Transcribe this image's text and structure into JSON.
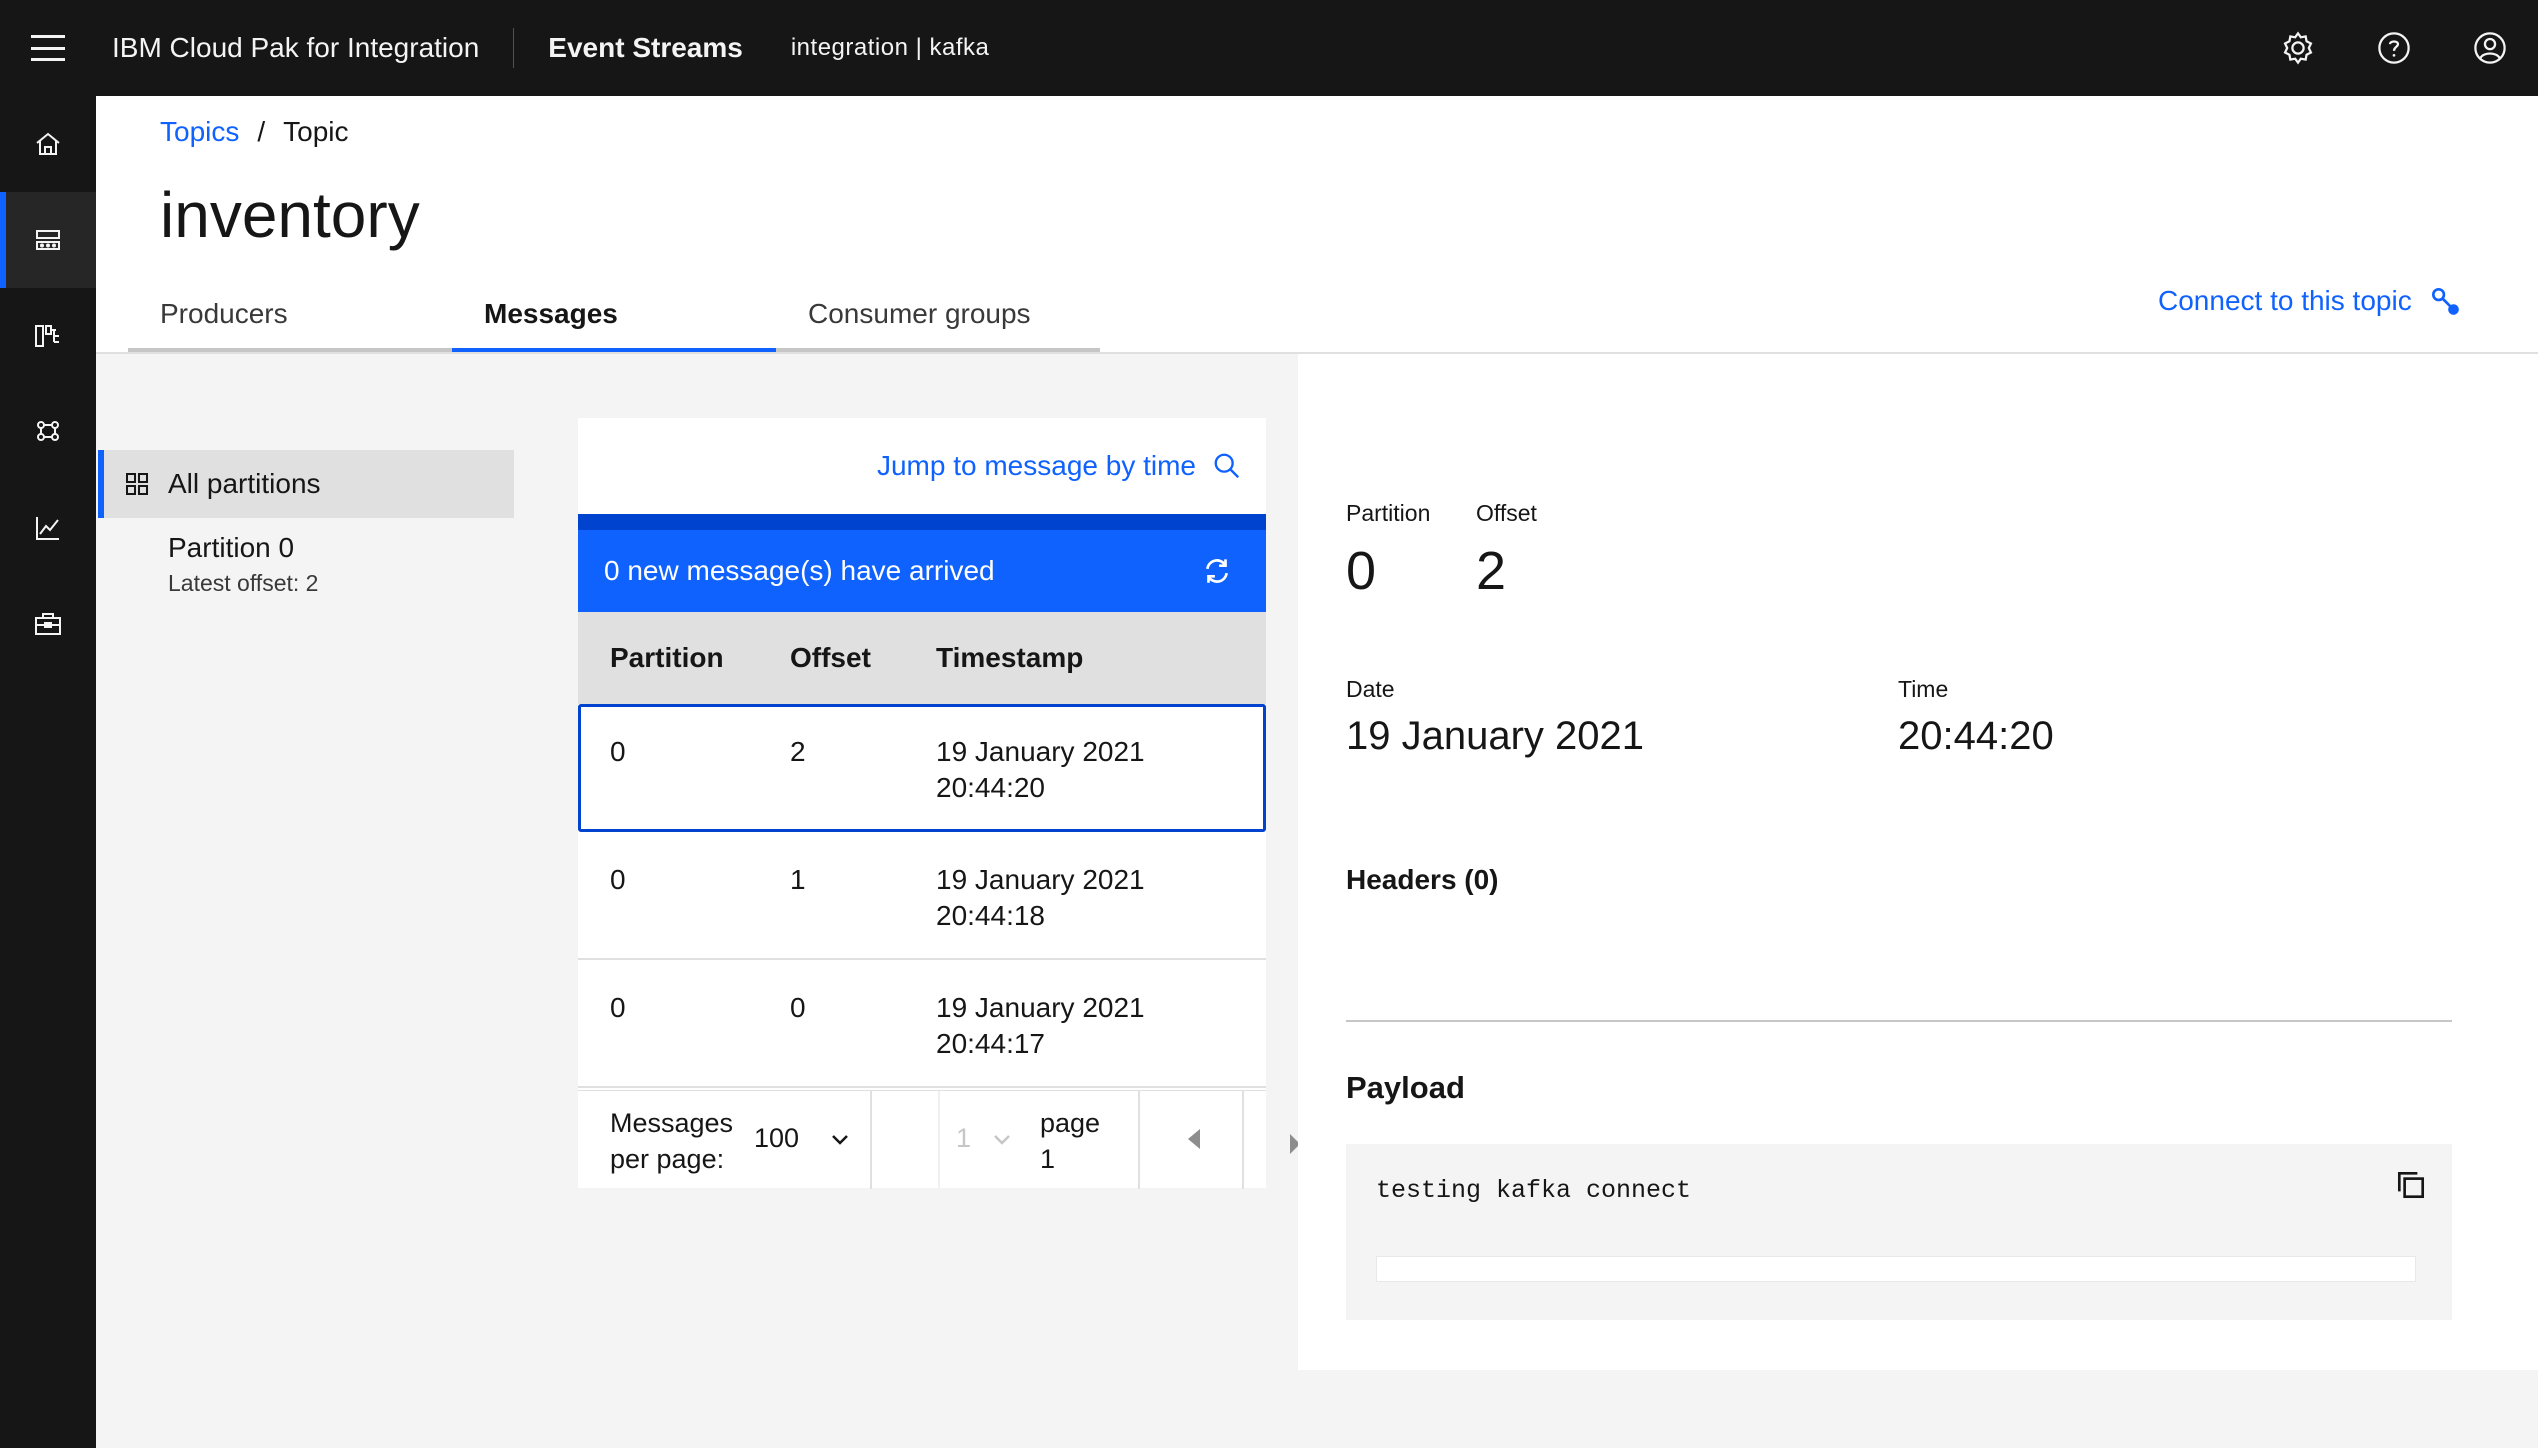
{
  "header": {
    "app_name": "IBM Cloud Pak for Integration",
    "product_name": "Event Streams",
    "namespace": "integration | kafka",
    "icons": [
      "menu-icon",
      "settings-icon",
      "help-icon",
      "user-avatar-icon"
    ]
  },
  "rail": {
    "items": [
      "home-icon",
      "topics-icon",
      "schema-icon",
      "consumer-groups-icon",
      "monitoring-icon",
      "toolbox-icon"
    ],
    "active_index": 1,
    "accent": "#0f62fe"
  },
  "breadcrumb": {
    "parent": "Topics",
    "separator": "/",
    "current": "Topic"
  },
  "page_title": "inventory",
  "tabs": [
    {
      "label": "Producers",
      "active": false
    },
    {
      "label": "Messages",
      "active": true
    },
    {
      "label": "Consumer groups",
      "active": false
    }
  ],
  "connect_link": "Connect to this topic",
  "partitions": {
    "all_label": "All partitions",
    "items": [
      {
        "name": "Partition 0",
        "latest_offset": "Latest offset: 2"
      }
    ]
  },
  "messages": {
    "jump_label": "Jump to message by time",
    "notice": "0 new message(s) have arrived",
    "columns": [
      "Partition",
      "Offset",
      "Timestamp"
    ],
    "rows": [
      {
        "partition": "0",
        "offset": "2",
        "date": "19 January 2021",
        "time": "20:44:20",
        "selected": true
      },
      {
        "partition": "0",
        "offset": "1",
        "date": "19 January 2021",
        "time": "20:44:18",
        "selected": false
      },
      {
        "partition": "0",
        "offset": "0",
        "date": "19 January 2021",
        "time": "20:44:17",
        "selected": false
      }
    ],
    "pagination": {
      "per_page_label_1": "Messages",
      "per_page_label_2": "per page:",
      "per_page_value": "100",
      "page_value": "1",
      "page_label_1": "page",
      "page_label_2": "1"
    }
  },
  "detail": {
    "partition_label": "Partition",
    "partition_value": "0",
    "offset_label": "Offset",
    "offset_value": "2",
    "date_label": "Date",
    "date_value": "19 January 2021",
    "time_label": "Time",
    "time_value": "20:44:20",
    "headers_label": "Headers (0)",
    "payload_label": "Payload",
    "payload_value": "testing kafka connect"
  }
}
